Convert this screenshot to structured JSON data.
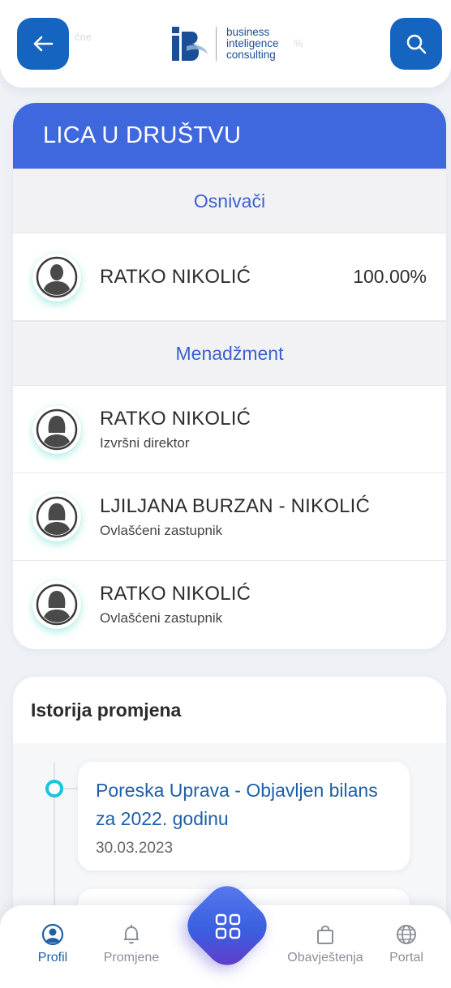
{
  "header": {
    "back_icon": "arrow-left-icon",
    "search_icon": "search-icon",
    "ghost_left": "čne",
    "ghost_right": "%",
    "logo_text": [
      "business",
      "inteligence",
      "consulting"
    ],
    "accent": "#1565c0"
  },
  "people": {
    "title": "LICA U DRUŠTVU",
    "founders_label": "Osnivači",
    "founders": [
      {
        "name": "RATKO NIKOLIĆ",
        "share": "100.00%",
        "avatar": "male-avatar-icon"
      }
    ],
    "management_label": "Menadžment",
    "management": [
      {
        "name": "RATKO NIKOLIĆ",
        "role": "Izvršni direktor",
        "avatar": "female-avatar-icon"
      },
      {
        "name": "LJILJANA BURZAN - NIKOLIĆ",
        "role": "Ovlašćeni zastupnik",
        "avatar": "female-avatar-icon"
      },
      {
        "name": "RATKO NIKOLIĆ",
        "role": "Ovlašćeni zastupnik",
        "avatar": "female-avatar-icon"
      }
    ],
    "header_color": "#3f68de"
  },
  "history": {
    "title": "Istorija promjena",
    "events": [
      {
        "title_line1": "Poreska Uprava - Objavljen bilans",
        "title_line2": "za 2022. godinu",
        "date": "30.03.2023"
      }
    ],
    "dot_color": "#16c5e0"
  },
  "nav": {
    "items": [
      {
        "label": "Profil",
        "icon": "profile-icon",
        "active": true
      },
      {
        "label": "Promjene",
        "icon": "bell-icon",
        "active": false
      },
      {
        "label": "Obavještenja",
        "icon": "shopping-bag-icon",
        "active": false
      },
      {
        "label": "Portal",
        "icon": "globe-icon",
        "active": false
      }
    ],
    "center_icon": "grid-icon"
  }
}
